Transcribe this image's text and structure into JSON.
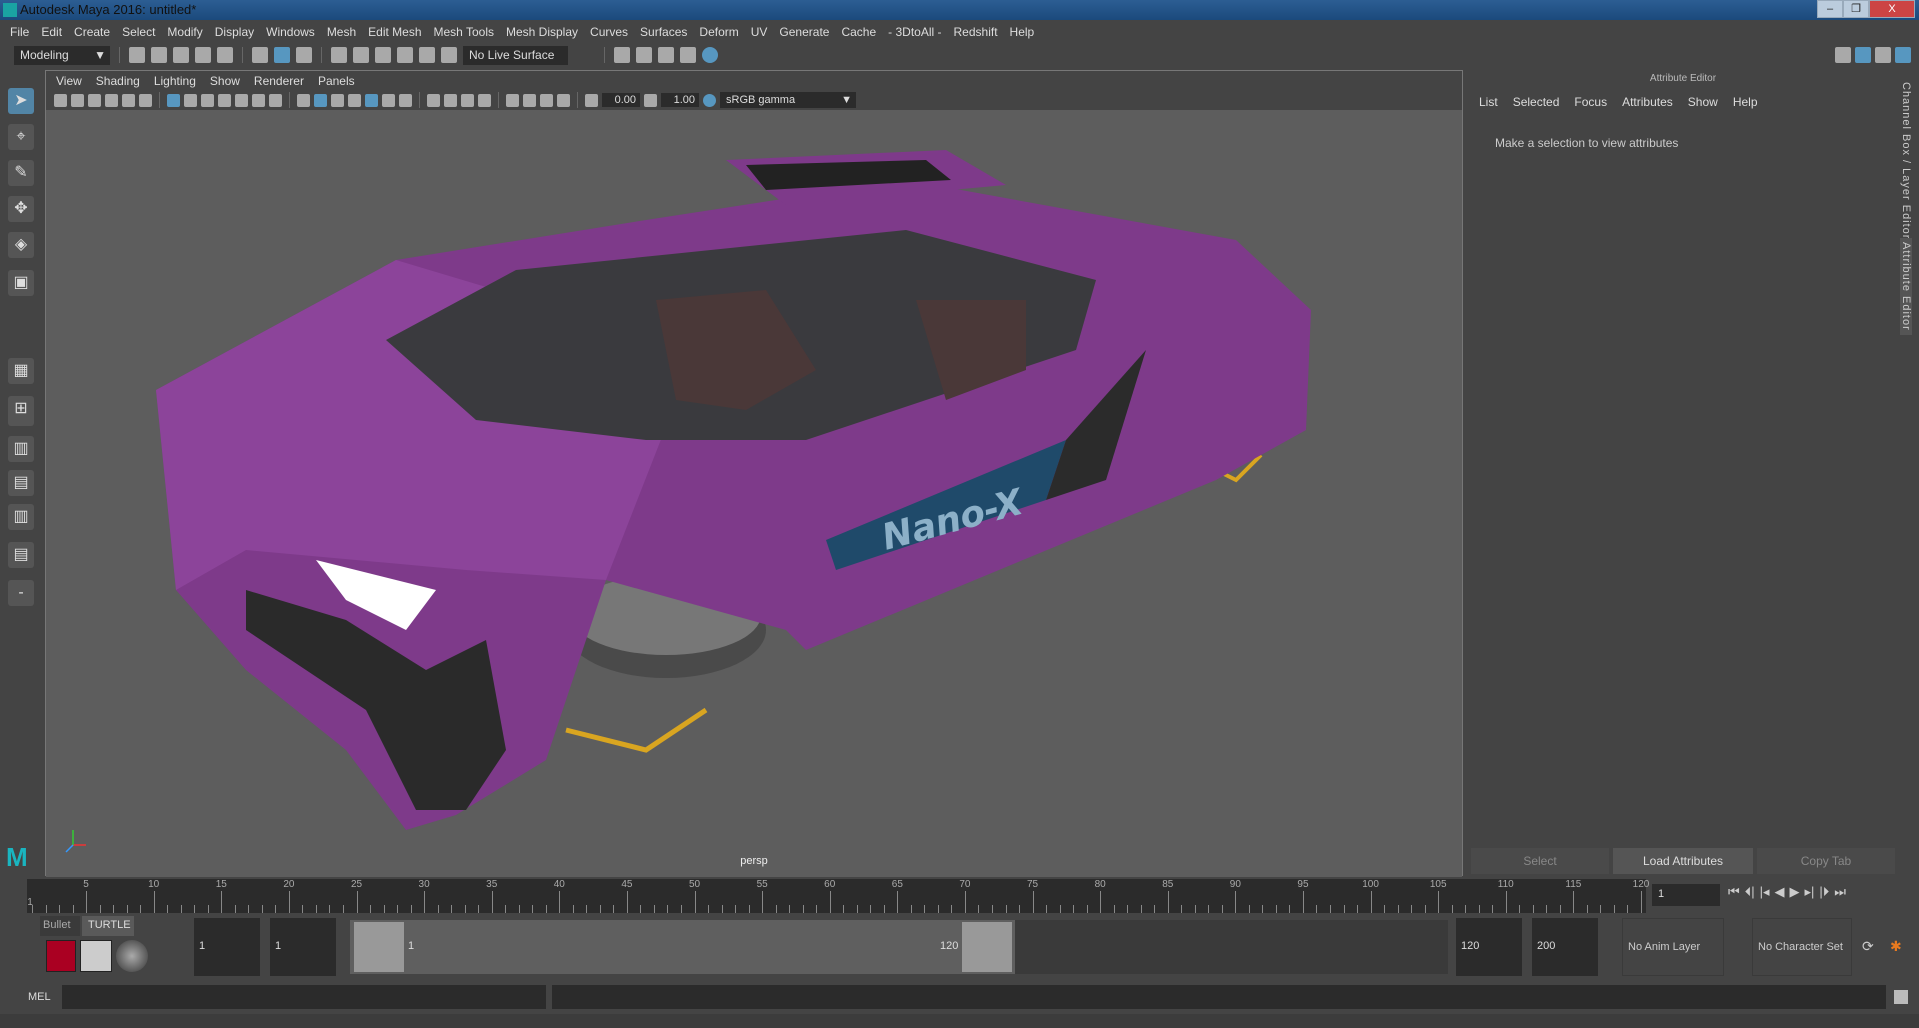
{
  "window": {
    "title": "Autodesk Maya 2016: untitled*",
    "minimize": "–",
    "restore": "❐",
    "close": "X"
  },
  "menu": [
    "File",
    "Edit",
    "Create",
    "Select",
    "Modify",
    "Display",
    "Windows",
    "Mesh",
    "Edit Mesh",
    "Mesh Tools",
    "Mesh Display",
    "Curves",
    "Surfaces",
    "Deform",
    "UV",
    "Generate",
    "Cache",
    "- 3DtoAll -",
    "Redshift",
    "Help"
  ],
  "shelf": {
    "mode": "Modeling",
    "live_surface": "No Live Surface"
  },
  "viewport": {
    "menu": [
      "View",
      "Shading",
      "Lighting",
      "Show",
      "Renderer",
      "Panels"
    ],
    "exposure": "0.00",
    "gamma": "1.00",
    "color_space": "sRGB gamma",
    "camera": "persp",
    "car_label": "Nano-X",
    "car_color": "#7e3a8a"
  },
  "attribute_editor": {
    "title": "Attribute Editor",
    "menu": [
      "List",
      "Selected",
      "Focus",
      "Attributes",
      "Show",
      "Help"
    ],
    "message": "Make a selection to view attributes",
    "buttons": [
      "Select",
      "Load Attributes",
      "Copy Tab"
    ]
  },
  "side_tabs": [
    "Channel Box / Layer Editor",
    "Attribute Editor"
  ],
  "timeline": {
    "labels": [
      "5",
      "10",
      "15",
      "20",
      "25",
      "30",
      "35",
      "40",
      "45",
      "50",
      "55",
      "60",
      "65",
      "70",
      "75",
      "80",
      "85",
      "90",
      "95",
      "100",
      "105",
      "110",
      "115",
      "120"
    ],
    "start_label": "1",
    "current_frame": "1"
  },
  "shelf_tabs": [
    "Bullet",
    "TURTLE"
  ],
  "range": {
    "start": "1",
    "playback_start": "1",
    "slider_start": "1",
    "slider_end": "120",
    "playback_end": "120",
    "end": "200",
    "anim_layer": "No Anim Layer",
    "character_set": "No Character Set"
  },
  "command": {
    "label": "MEL"
  }
}
